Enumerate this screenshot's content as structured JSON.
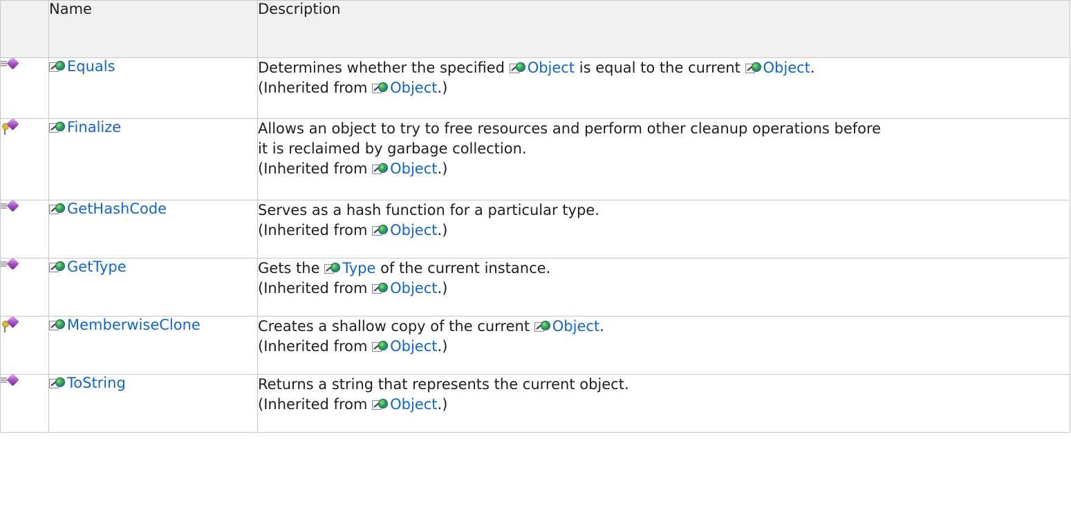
{
  "header": {
    "name": "Name",
    "description": "Description"
  },
  "inherited_prefix": "(Inherited from ",
  "inherited_suffix": ".)",
  "rows": [
    {
      "icon": "public-method-icon",
      "name": "Equals",
      "desc": {
        "p1": "Determines whether the specified ",
        "l1": "Object",
        "p2": " is equal to the current ",
        "l2": "Object",
        "p3": "."
      },
      "inherited_from": "Object"
    },
    {
      "icon": "protected-method-icon",
      "name": "Finalize",
      "desc": {
        "line1": "Allows an object to try to free resources and perform other cleanup operations before",
        "line2": "it is reclaimed by garbage collection."
      },
      "inherited_from": "Object"
    },
    {
      "icon": "public-method-icon",
      "name": "GetHashCode",
      "desc": {
        "text": "Serves as a hash function for a particular type."
      },
      "inherited_from": "Object"
    },
    {
      "icon": "public-method-icon",
      "name": "GetType",
      "desc": {
        "p1": "Gets the ",
        "l1": "Type",
        "p2": " of the current instance."
      },
      "inherited_from": "Object"
    },
    {
      "icon": "protected-method-icon",
      "name": "MemberwiseClone",
      "desc": {
        "p1": "Creates a shallow copy of the current ",
        "l1": "Object",
        "p2": "."
      },
      "inherited_from": "Object"
    },
    {
      "icon": "public-method-icon",
      "name": "ToString",
      "desc": {
        "text": "Returns a string that represents the current object."
      },
      "inherited_from": "Object"
    }
  ]
}
